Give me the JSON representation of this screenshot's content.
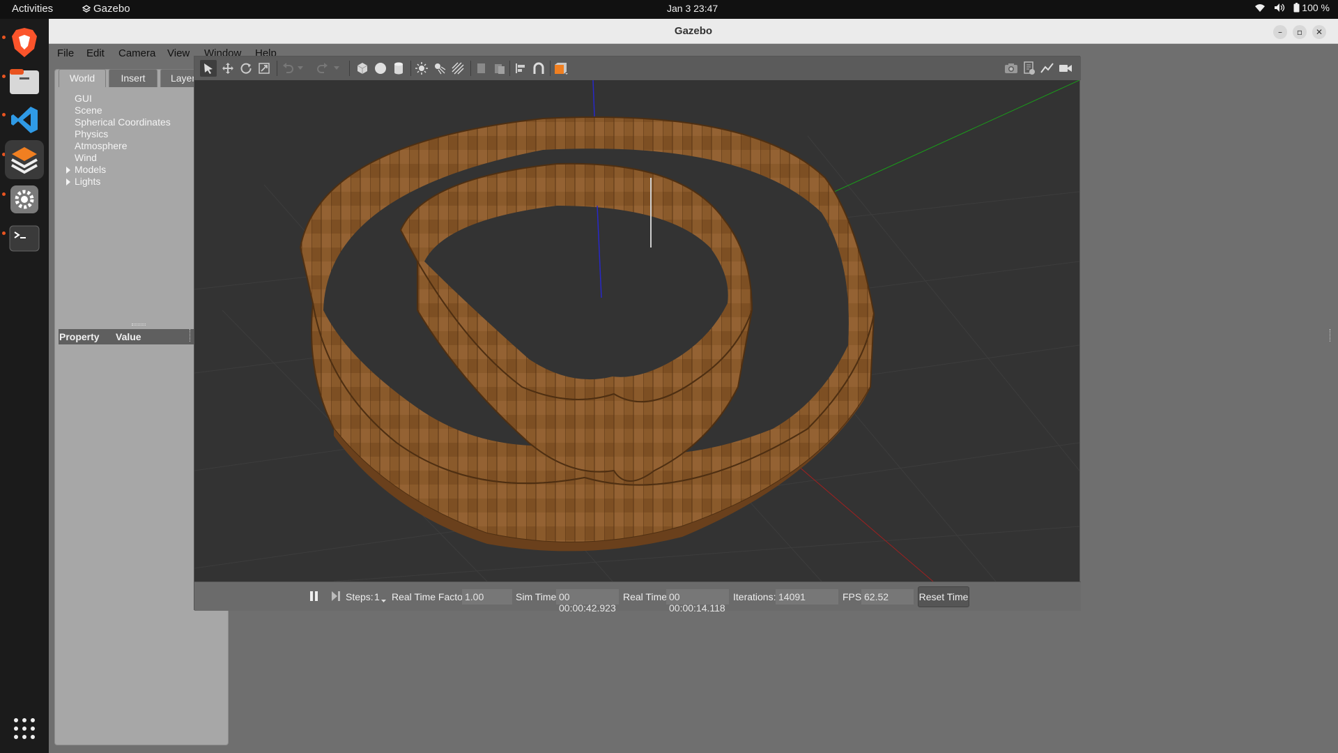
{
  "topbar": {
    "activities": "Activities",
    "app_name": "Gazebo",
    "clock": "Jan 3  23:47",
    "battery": "100 %"
  },
  "dock": {
    "items": [
      {
        "name": "brave-browser-icon"
      },
      {
        "name": "files-icon"
      },
      {
        "name": "vscode-icon"
      },
      {
        "name": "gazebo-icon"
      },
      {
        "name": "settings-icon"
      },
      {
        "name": "terminal-icon"
      },
      {
        "name": "show-apps-icon"
      }
    ]
  },
  "window": {
    "title": "Gazebo",
    "menu": [
      "File",
      "Edit",
      "Camera",
      "View",
      "Window",
      "Help"
    ]
  },
  "left_panel": {
    "tabs": [
      "World",
      "Insert",
      "Layers"
    ],
    "active_tab": "World",
    "tree": [
      "GUI",
      "Scene",
      "Spherical Coordinates",
      "Physics",
      "Atmosphere",
      "Wind",
      "Models",
      "Lights"
    ],
    "property_header": "Property",
    "value_header": "Value"
  },
  "toolbar": {
    "tools": [
      "select-arrow-icon",
      "translate-icon",
      "rotate-icon",
      "scale-icon",
      "undo-icon",
      "redo-icon",
      "box-icon",
      "sphere-icon",
      "cylinder-icon",
      "point-light-icon",
      "spot-light-icon",
      "directional-light-icon",
      "copy-icon",
      "paste-icon",
      "align-icon",
      "snap-icon",
      "view-angle-icon",
      "screenshot-icon",
      "log-icon",
      "plot-icon",
      "video-record-icon"
    ]
  },
  "bottom": {
    "steps_label": "Steps:",
    "steps_value": "1",
    "rtf_label": "Real Time Factor:",
    "rtf_value": "1.00",
    "sim_time_label": "Sim Time:",
    "sim_time_value": "00 00:00:42.923",
    "real_time_label": "Real Time:",
    "real_time_value": "00 00:00:14.118",
    "iterations_label": "Iterations:",
    "iterations_value": "14091",
    "fps_label": "FPS:",
    "fps_value": "62.52",
    "reset_label": "Reset Time"
  },
  "colors": {
    "accent": "#e95420",
    "wall": "#8a5a2b",
    "viewport_bg": "#333333"
  }
}
